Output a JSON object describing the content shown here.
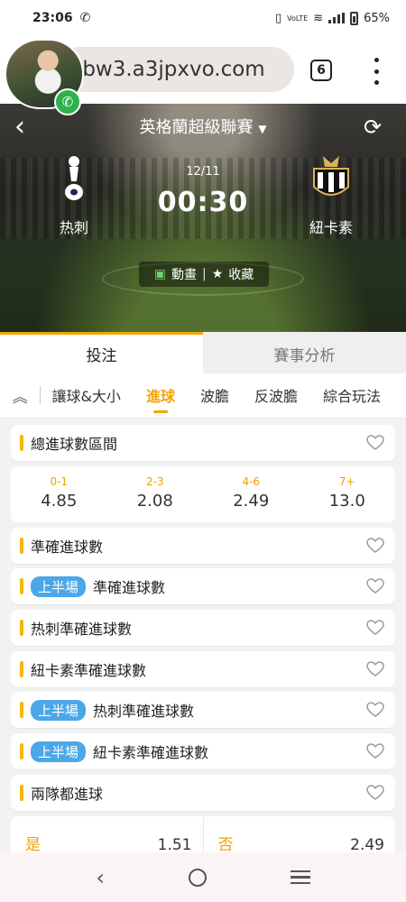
{
  "status_bar": {
    "time": "23:06",
    "network": "VoLTE",
    "battery": "65%"
  },
  "browser": {
    "url": "bw3.a3jpxvo.com",
    "tab_count": "6"
  },
  "match": {
    "league": "英格蘭超級聯賽",
    "date": "12/11",
    "time": "00:30",
    "home": "热刺",
    "away": "紐卡素",
    "animation_label": "動畫",
    "favorite_label": "收藏"
  },
  "main_tabs": [
    "投注",
    "賽事分析"
  ],
  "sub_tabs": [
    "讓球&大小",
    "進球",
    "波膽",
    "反波膽",
    "綜合玩法"
  ],
  "markets": [
    {
      "label": "總進球數區間",
      "badge": ""
    },
    {
      "label": "準確進球數",
      "badge": ""
    },
    {
      "label": "準確進球數",
      "badge": "上半場"
    },
    {
      "label": "热刺準確進球數",
      "badge": ""
    },
    {
      "label": "紐卡素準確進球數",
      "badge": ""
    },
    {
      "label": "热刺準確進球數",
      "badge": "上半場"
    },
    {
      "label": "紐卡素準確進球數",
      "badge": "上半場"
    },
    {
      "label": "兩隊都進球",
      "badge": ""
    }
  ],
  "goal_range_odds": [
    {
      "label": "0-1",
      "value": "4.85"
    },
    {
      "label": "2-3",
      "value": "2.08"
    },
    {
      "label": "4-6",
      "value": "2.49"
    },
    {
      "label": "7+",
      "value": "13.0"
    }
  ],
  "both_score": [
    {
      "label": "是",
      "value": "1.51"
    },
    {
      "label": "否",
      "value": "2.49"
    }
  ],
  "colors": {
    "accent": "#f5a300",
    "badge": "#4ba7e8",
    "call": "#2fb24c"
  }
}
